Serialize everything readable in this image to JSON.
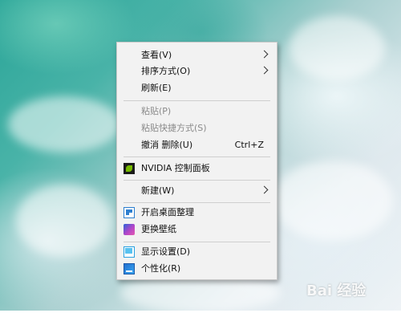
{
  "menu": {
    "items": [
      {
        "label": "查看(V)",
        "submenu": true
      },
      {
        "label": "排序方式(O)",
        "submenu": true
      },
      {
        "label": "刷新(E)"
      },
      {
        "label": "粘贴(P)",
        "disabled": true
      },
      {
        "label": "粘贴快捷方式(S)",
        "disabled": true
      },
      {
        "label": "撤消 删除(U)",
        "shortcut": "Ctrl+Z"
      },
      {
        "label": "NVIDIA 控制面板",
        "icon": "nvidia-icon"
      },
      {
        "label": "新建(W)",
        "submenu": true
      },
      {
        "label": "开启桌面整理",
        "icon": "desktop-organize-icon"
      },
      {
        "label": "更换壁纸",
        "icon": "wallpaper-icon"
      },
      {
        "label": "显示设置(D)",
        "icon": "display-settings-icon"
      },
      {
        "label": "个性化(R)",
        "icon": "personalize-icon"
      }
    ]
  },
  "watermark": "Bai 经验"
}
